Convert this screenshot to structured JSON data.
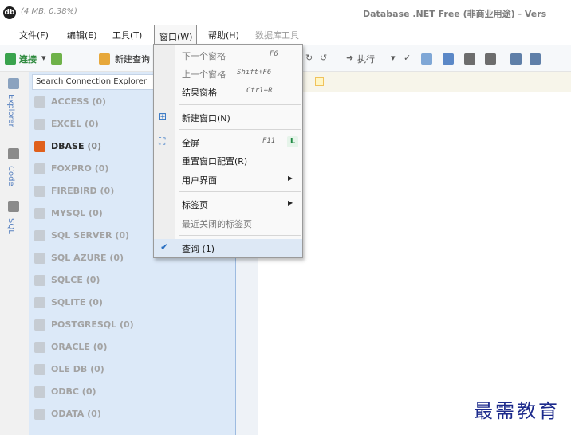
{
  "titlebar": {
    "memory": "(4 MB, 0.38%)",
    "app_title": "Database .NET Free (非商业用途) - Vers"
  },
  "menubar": [
    "文件(F)",
    "编辑(E)",
    "工具(T)",
    "窗口(W)",
    "帮助(H)",
    "数据库工具"
  ],
  "toolbar": {
    "connect_label": "连接",
    "new_query_label": "新建查询",
    "execute_label": "执行"
  },
  "side_tabs": [
    "Explorer",
    "Code",
    "SQL"
  ],
  "explorer": {
    "search_placeholder": "Search Connection Explorer",
    "connections": [
      {
        "name": "ACCESS",
        "count": "(0)"
      },
      {
        "name": "EXCEL",
        "count": "(0)"
      },
      {
        "name": "DBASE",
        "count": "(0)"
      },
      {
        "name": "FOXPRO",
        "count": "(0)"
      },
      {
        "name": "FIREBIRD",
        "count": "(0)"
      },
      {
        "name": "MYSQL",
        "count": "(0)"
      },
      {
        "name": "SQL SERVER",
        "count": "(0)"
      },
      {
        "name": "SQL AZURE",
        "count": "(0)"
      },
      {
        "name": "SQLCE",
        "count": "(0)"
      },
      {
        "name": "SQLITE",
        "count": "(0)"
      },
      {
        "name": "POSTGRESQL",
        "count": "(0)"
      },
      {
        "name": "ORACLE",
        "count": "(0)"
      },
      {
        "name": "OLE DB",
        "count": "(0)"
      },
      {
        "name": "ODBC",
        "count": "(0)"
      },
      {
        "name": "ODATA",
        "count": "(0)"
      }
    ],
    "selected": "DBASE"
  },
  "doc_tab": {
    "close": "×"
  },
  "window_menu": {
    "items": [
      {
        "label": "下一个窗格",
        "shortcut": "F6"
      },
      {
        "label": "上一个窗格",
        "shortcut": "Shift+F6"
      },
      {
        "label": "结果窗格",
        "shortcut": "Ctrl+R"
      },
      {
        "label": "新建窗口(N)",
        "shortcut": ""
      },
      {
        "label": "全屏",
        "shortcut": "F11",
        "badge": "L"
      },
      {
        "label": "重置窗口配置(R)",
        "shortcut": ""
      },
      {
        "label": "用户界面",
        "shortcut": "",
        "submenu": true
      },
      {
        "label": "标签页",
        "shortcut": "",
        "submenu": true
      },
      {
        "label": "最近关闭的标签页",
        "shortcut": ""
      },
      {
        "label": "查询 (1)",
        "shortcut": "",
        "checked": true
      }
    ]
  },
  "watermark": "最需教育",
  "colors": {
    "explorer_bg": "#dce9f8",
    "selected_icon": "#e0601c",
    "accent": "#2a6fc1",
    "watermark": "#1c2a8c"
  }
}
